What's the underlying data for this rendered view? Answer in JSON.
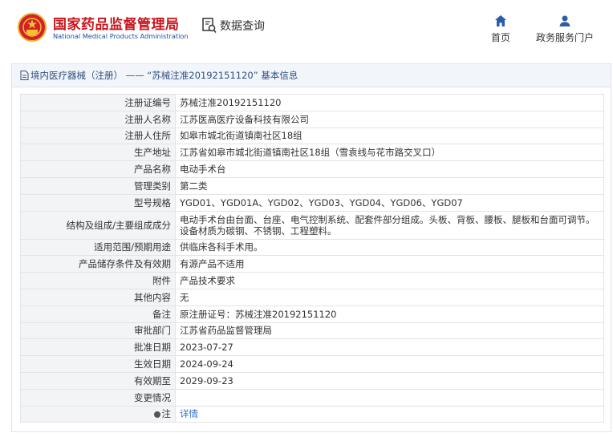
{
  "header": {
    "title": "国家药品监督管理局",
    "subtitle": "National Medical Products Administration",
    "query_label": "数据查询",
    "nav": [
      {
        "label": "首页",
        "icon": "home-icon"
      },
      {
        "label": "政务服务门户",
        "icon": "user-icon"
      }
    ]
  },
  "breadcrumb": {
    "text": "境内医疗器械（注册） —— “苏械注准20192151120” 基本信息"
  },
  "rows": [
    {
      "key": "注册证编号",
      "value": "苏械注准20192151120"
    },
    {
      "key": "注册人名称",
      "value": "江苏医高医疗设备科技有限公司"
    },
    {
      "key": "注册人住所",
      "value": "如皋市城北街道镇南社区18组"
    },
    {
      "key": "生产地址",
      "value": "江苏省如皋市城北街道镇南社区18组（雪袁线与花市路交叉口）"
    },
    {
      "key": "产品名称",
      "value": "电动手术台"
    },
    {
      "key": "管理类别",
      "value": "第二类"
    },
    {
      "key": "型号规格",
      "value": "YGD01、YGD01A、YGD02、YGD03、YGD04、YGD06、YGD07"
    },
    {
      "key": "结构及组成/主要组成成分",
      "value": "电动手术台由台面、台座、电气控制系统、配套件部分组成。头板、背板、腰板、腿板和台面可调节。设备材质为碳钢、不锈钢、工程塑料。"
    },
    {
      "key": "适用范围/预期用途",
      "value": "供临床各科手术用。"
    },
    {
      "key": "产品储存条件及有效期",
      "value": "有源产品不适用"
    },
    {
      "key": "附件",
      "value": "产品技术要求"
    },
    {
      "key": "其他内容",
      "value": "无"
    },
    {
      "key": "备注",
      "value": "原注册证号：苏械注准20192151120"
    },
    {
      "key": "审批部门",
      "value": "江苏省药品监督管理局"
    },
    {
      "key": "批准日期",
      "value": "2023-07-27"
    },
    {
      "key": "生效日期",
      "value": "2024-09-24"
    },
    {
      "key": "有效期至",
      "value": "2029-09-23"
    },
    {
      "key": "变更情况",
      "value": ""
    }
  ],
  "note_row": {
    "key": "注",
    "link": "详情"
  }
}
